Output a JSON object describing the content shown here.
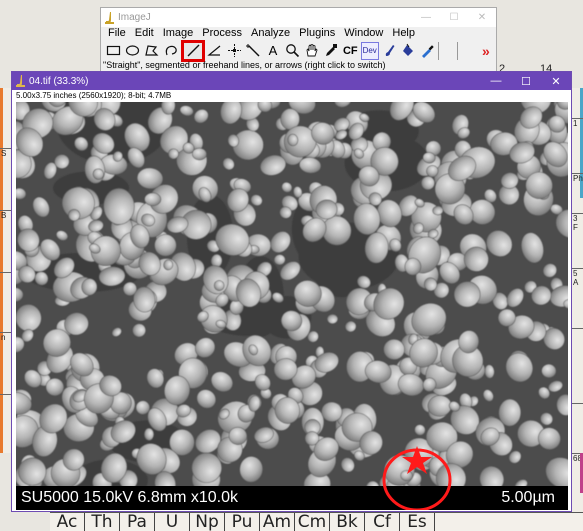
{
  "background": {
    "top_numbers": [
      "2",
      "14"
    ],
    "left_labels": [
      "S",
      "",
      "B",
      "",
      "",
      "",
      "",
      "",
      "n",
      "",
      ""
    ],
    "right_labels": [
      "",
      "1",
      "",
      "Ph",
      "3",
      "F",
      "",
      "5",
      "A",
      "",
      "68"
    ],
    "bottom_elements": [
      "Ac",
      "Th",
      "Pa",
      "U",
      "Np",
      "Pu",
      "Am",
      "Cm",
      "Bk",
      "Cf",
      "Es"
    ]
  },
  "imagej": {
    "title": "ImageJ",
    "window_buttons": [
      "—",
      "☐",
      "✕"
    ],
    "menus": [
      "File",
      "Edit",
      "Image",
      "Process",
      "Analyze",
      "Plugins",
      "Window",
      "Help"
    ],
    "tools": [
      {
        "name": "rectangle-tool",
        "icon": "rectangle-icon"
      },
      {
        "name": "oval-tool",
        "icon": "oval-icon"
      },
      {
        "name": "polygon-tool",
        "icon": "polygon-icon"
      },
      {
        "name": "freehand-tool",
        "icon": "freehand-icon"
      },
      {
        "name": "straight-line-tool",
        "icon": "straight-line-icon",
        "active": true
      },
      {
        "name": "angle-tool",
        "icon": "angle-icon"
      },
      {
        "name": "point-tool",
        "icon": "crosshair-point-icon"
      },
      {
        "name": "wand-tool",
        "icon": "wand-icon"
      },
      {
        "name": "text-tool",
        "icon": "text-a-icon",
        "text": "A"
      },
      {
        "name": "magnifying-tool",
        "icon": "magnifier-icon"
      },
      {
        "name": "scrolling-tool",
        "icon": "hand-icon"
      },
      {
        "name": "color-picker-tool",
        "icon": "dropper-icon"
      },
      {
        "name": "cf-tool",
        "icon": "cf-icon",
        "text": "CF"
      },
      {
        "name": "dev-tool",
        "icon": "dev-icon",
        "text": "Dev"
      },
      {
        "name": "brush-tool",
        "icon": "brush-icon"
      },
      {
        "name": "flood-fill-tool",
        "icon": "flood-fill-icon"
      },
      {
        "name": "pipette-tool",
        "icon": "pipette-icon"
      },
      {
        "name": "more-tools",
        "icon": "double-chevron-right-icon",
        "text": "»"
      }
    ],
    "status": "\"Straight\", segmented or freehand lines, or arrows (right click to switch)"
  },
  "image_window": {
    "title": "04.tif (33.3%)",
    "window_buttons": [
      "—",
      "☐",
      "✕"
    ],
    "info": "5.00x3.75 inches (2560x1920); 8-bit; 4.7MB",
    "sem_label": "SU5000 15.0kV 6.8mm x10.0k",
    "scale_text": "5.00µm"
  },
  "colors": {
    "accent_title": "#6b46b8",
    "highlight": "#e00000",
    "annotation": "#ff1a1a",
    "scalebar": "#f2f22a"
  }
}
